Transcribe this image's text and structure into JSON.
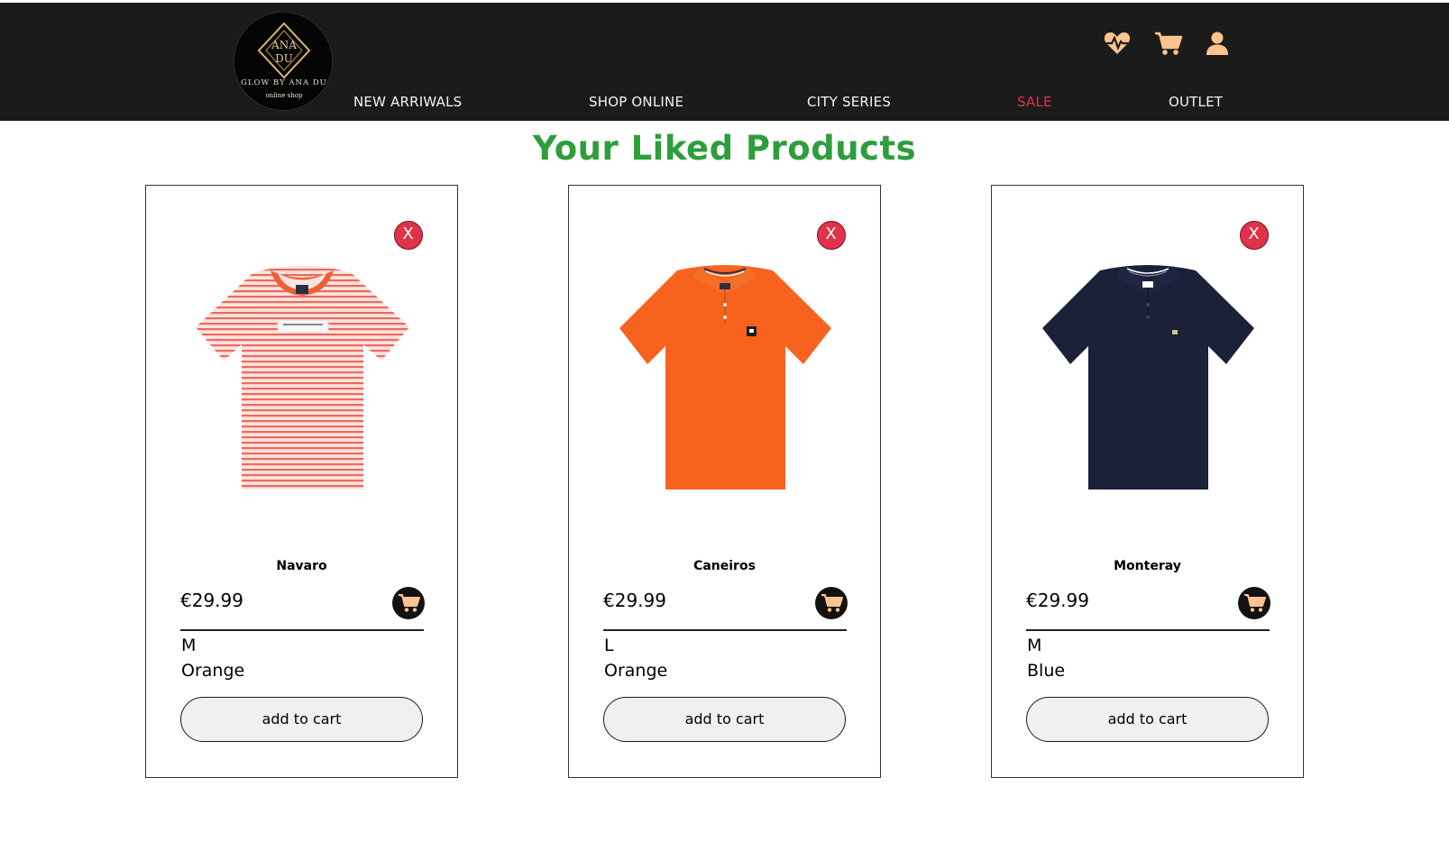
{
  "brand": {
    "logo_initials": "ANA DU",
    "logo_line1": "GLOW BY ANA DU",
    "logo_line2": "online shop",
    "colors": {
      "gold": "#d9b76a",
      "navbar_bg": "#1c1b1b",
      "sale_red": "#e0324a",
      "title_green": "#2e9e3b",
      "icon_peach": "#ffc38f"
    }
  },
  "nav": {
    "links": [
      {
        "label": "NEW ARRIWALS"
      },
      {
        "label": "SHOP ONLINE"
      },
      {
        "label": "CITY SERIES"
      },
      {
        "label": "SALE"
      },
      {
        "label": "OUTLET"
      }
    ],
    "icons": [
      "heart-pulse-icon",
      "cart-icon",
      "user-icon"
    ]
  },
  "page": {
    "title": "Your Liked Products"
  },
  "products": [
    {
      "name": "Navaro",
      "price": "€29.99",
      "size": "M",
      "color": "Orange",
      "add_label": "add to cart",
      "remove_label": "X"
    },
    {
      "name": "Caneiros",
      "price": "€29.99",
      "size": "L",
      "color": "Orange",
      "add_label": "add to cart",
      "remove_label": "X"
    },
    {
      "name": "Monteray",
      "price": "€29.99",
      "size": "M",
      "color": "Blue",
      "add_label": "add to cart",
      "remove_label": "X"
    }
  ]
}
